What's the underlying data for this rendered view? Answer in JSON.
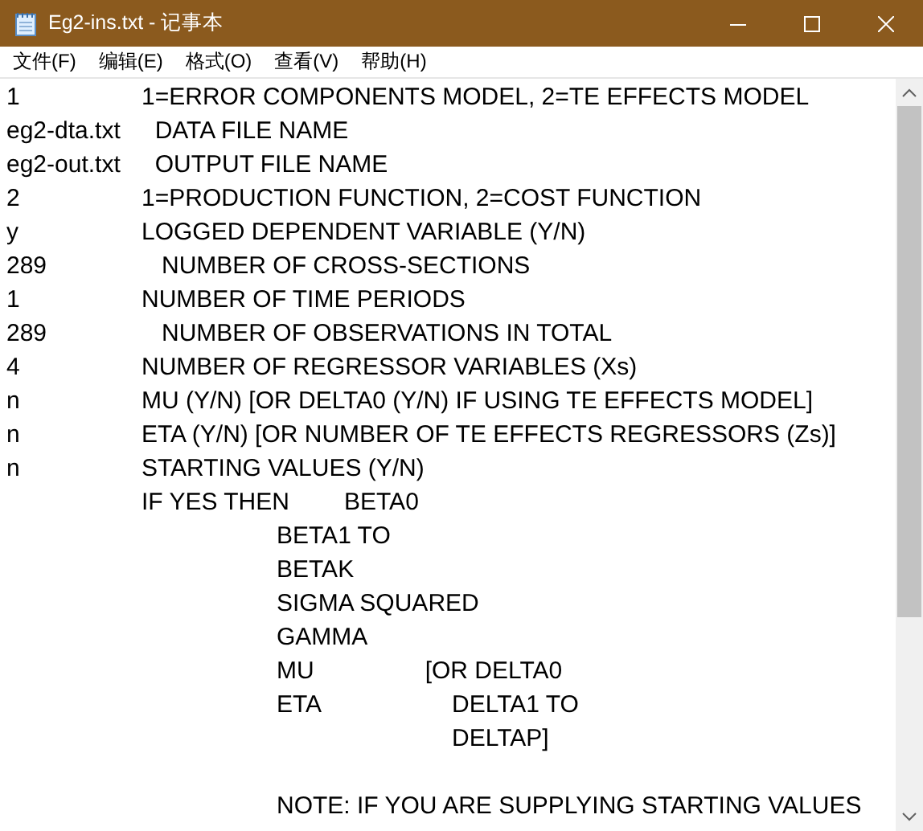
{
  "window": {
    "title": "Eg2-ins.txt - 记事本"
  },
  "menu": [
    "文件(F)",
    "编辑(E)",
    "格式(O)",
    "查看(V)",
    "帮助(H)"
  ],
  "document": {
    "paragraphs": [
      [
        "1\t\t1=ERROR COMPONENTS MODEL, 2=TE EFFECTS MODEL",
        "eg2-dta.txt\t  DATA FILE NAME",
        "eg2-out.txt\t  OUTPUT FILE NAME",
        "2\t\t1=PRODUCTION FUNCTION, 2=COST FUNCTION",
        "y\t\tLOGGED DEPENDENT VARIABLE (Y/N)",
        "289\t\t   NUMBER OF CROSS-SECTIONS",
        "1\t\tNUMBER OF TIME PERIODS",
        "289\t\t   NUMBER OF OBSERVATIONS IN TOTAL",
        "4\t\tNUMBER OF REGRESSOR VARIABLES (Xs)",
        "n\t\tMU (Y/N) [OR DELTA0 (Y/N) IF USING TE EFFECTS MODEL]",
        "n\t\tETA (Y/N) [OR NUMBER OF TE EFFECTS REGRESSORS (Zs)]",
        "n\t\tSTARTING VALUES (Y/N)",
        "\t\tIF YES THEN\tBETA0",
        "\t\t\t\tBETA1 TO",
        "\t\t\t\tBETAK",
        "\t\t\t\tSIGMA SQUARED",
        "\t\t\t\tGAMMA",
        "\t\t\t\tMU\t\t  [OR DELTA0",
        "\t\t\t\tETA\t\t      DELTA1 TO",
        "\t\t\t\t\t\t      DELTAP]"
      ],
      [
        "\t\t\t\tNOTE: IF YOU ARE SUPPLYING STARTING VALUES"
      ]
    ]
  }
}
